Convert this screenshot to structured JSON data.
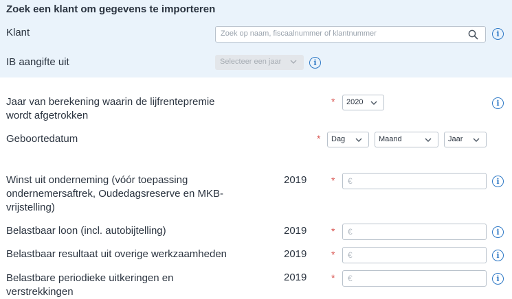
{
  "search_section": {
    "title": "Zoek een klant om gegevens te importeren",
    "client_label": "Klant",
    "client_search_placeholder": "Zoek op naam, fiscaalnummer of klantnummer",
    "ib_label": "IB aangifte uit",
    "ib_select_value": "Selecteer een jaar"
  },
  "form": {
    "rows": [
      {
        "label_line1": "Jaar van berekening waarin de lijfrentepremie",
        "label_line2": "wordt afgetrokken",
        "select_value": "2020"
      },
      {
        "label": "Geboortedatum",
        "day": "Dag",
        "month": "Maand",
        "year": "Jaar"
      },
      {
        "label_line1": "Winst uit onderneming (vóór toepassing",
        "label_line2": "ondernemersaftrek, Oudedagsreserve en MKB-",
        "label_line3": "vrijstelling)",
        "year": "2019",
        "value": ""
      },
      {
        "label": "Belastbaar loon (incl. autobijtelling)",
        "year": "2019",
        "value": ""
      },
      {
        "label": "Belastbaar resultaat uit overige werkzaamheden",
        "year": "2019",
        "value": ""
      },
      {
        "label_line1": "Belastbare periodieke uitkeringen en",
        "label_line2": "verstrekkingen",
        "year": "2019",
        "value": ""
      }
    ],
    "required_marker": "*",
    "currency_symbol": "€",
    "info_symbol": "i"
  },
  "colors": {
    "panel_bg": "#eaf3fb",
    "accent": "#2f79c6",
    "required": "#d9534f"
  }
}
